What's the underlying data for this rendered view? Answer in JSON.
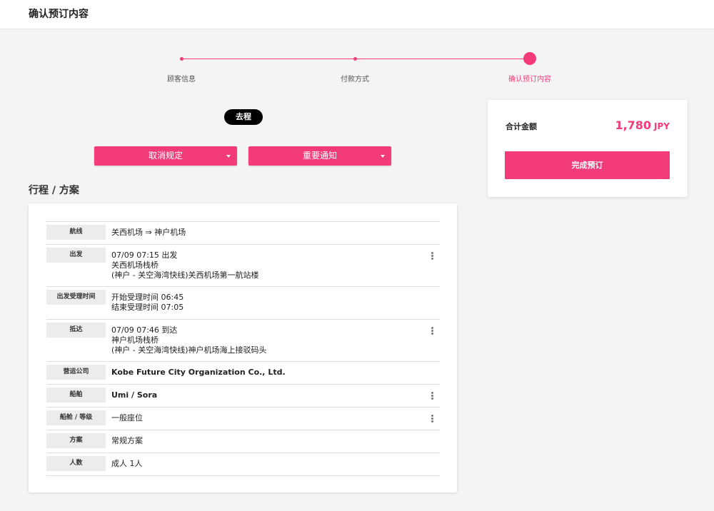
{
  "header": {
    "title": "确认预订内容"
  },
  "stepper": {
    "steps": [
      {
        "label": "顾客信息"
      },
      {
        "label": "付款方式"
      },
      {
        "label": "确认预订内容"
      }
    ]
  },
  "direction": {
    "label": "去程"
  },
  "dropdowns": {
    "cancel_policy": "取消规定",
    "important_notice": "重要通知"
  },
  "section": {
    "title": "行程 / 方案"
  },
  "itinerary": {
    "rows": [
      {
        "label": "航线",
        "lines": [
          "关西机场 ⇒ 神户机场"
        ]
      },
      {
        "label": "出发",
        "lines": [
          "07/09 07:15 出发",
          "关西机场栈桥",
          "(神户 - 关空海湾快线)关西机场第一航站楼"
        ]
      },
      {
        "label": "出发受理时间",
        "lines": [
          "开始受理时间 06:45",
          "结束受理时间 07:05"
        ]
      },
      {
        "label": "抵达",
        "lines": [
          "07/09 07:46 到达",
          "神户机场栈桥",
          "(神户 - 关空海湾快线)神户机场海上接驳码头"
        ]
      },
      {
        "label": "营运公司",
        "lines": [
          "Kobe Future City Organization Co., Ltd."
        ]
      },
      {
        "label": "船舶",
        "lines": [
          "Umi / Sora"
        ]
      },
      {
        "label": "船舱 / 等级",
        "lines": [
          "一般座位"
        ]
      },
      {
        "label": "方案",
        "lines": [
          "常规方案"
        ]
      },
      {
        "label": "人数",
        "lines": [
          "成人 1人"
        ]
      }
    ]
  },
  "summary": {
    "total_label": "合计金额",
    "amount": "1,780",
    "currency": "JPY",
    "complete_button": "完成预订"
  },
  "colors": {
    "accent": "#f43b7a",
    "pill": "#000000"
  }
}
